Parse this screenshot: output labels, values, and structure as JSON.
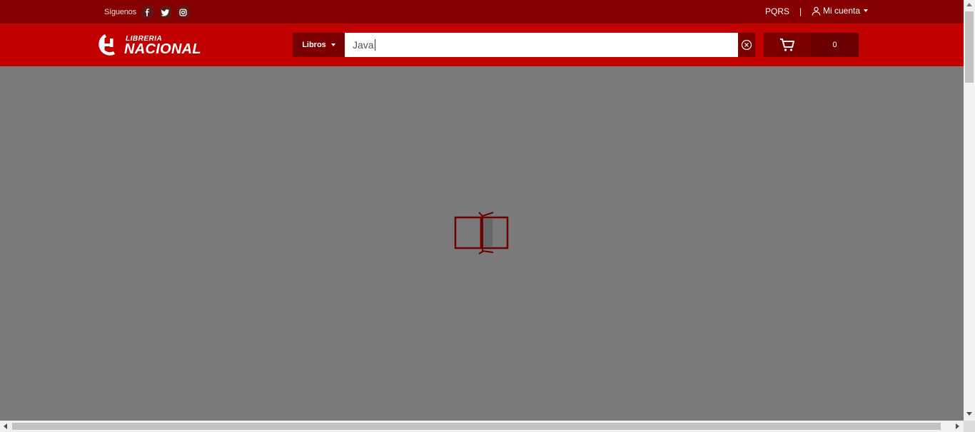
{
  "topbar": {
    "follow_label": "Síguenos",
    "social": [
      {
        "name": "facebook-icon"
      },
      {
        "name": "twitter-icon"
      },
      {
        "name": "instagram-icon"
      }
    ],
    "pqrs_label": "PQRS",
    "separator": "|",
    "account_label": "Mi cuenta"
  },
  "header": {
    "logo_small": "LIBRERIA",
    "logo_big": "NACIONAL",
    "category_label": "Libros",
    "search_value": "Java",
    "cart_count": "0"
  },
  "colors": {
    "topbar": "#850000",
    "header": "#c10000",
    "dark_button": "#7a0000",
    "overlay": "#7a7a7a",
    "loader": "#6e0000"
  },
  "loader": {
    "icon": "loading-book-icon"
  }
}
